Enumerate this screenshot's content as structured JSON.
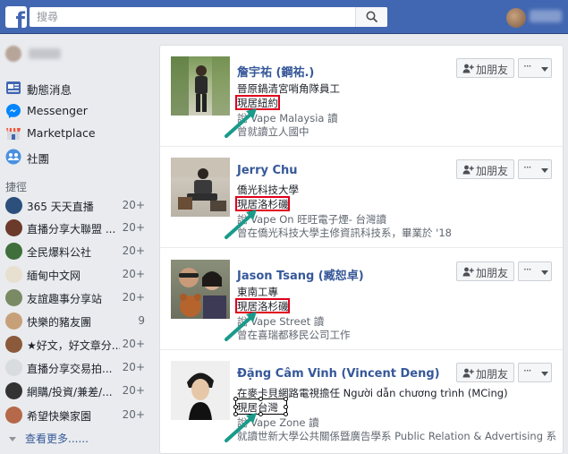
{
  "search": {
    "placeholder": "搜尋"
  },
  "sidebar": {
    "items": [
      {
        "label": "動態消息",
        "icon": "news-feed-icon"
      },
      {
        "label": "Messenger",
        "icon": "messenger-icon"
      },
      {
        "label": "Marketplace",
        "icon": "marketplace-icon"
      },
      {
        "label": "社團",
        "icon": "groups-icon"
      }
    ],
    "shortcuts_title": "捷徑",
    "shortcuts": [
      {
        "label": "365 天天直播",
        "count": "20+"
      },
      {
        "label": "直播分享大聯盟 ...",
        "count": "20+"
      },
      {
        "label": "全民爆料公社",
        "count": "20+"
      },
      {
        "label": "緬甸中文网",
        "count": "20+"
      },
      {
        "label": "友誼趣事分享站",
        "count": "20+"
      },
      {
        "label": "快樂的豬友團",
        "count": "9"
      },
      {
        "label": "★好文，好文章分...",
        "count": "20+"
      },
      {
        "label": "直播分享交易拍...",
        "count": "20+"
      },
      {
        "label": "網購/投資/兼差/...",
        "count": "20+"
      },
      {
        "label": "希望快樂家園",
        "count": "20+"
      }
    ],
    "see_more": "查看更多......"
  },
  "suggestions": [
    {
      "name": "詹宇祐 (鋼祐.)",
      "line1": "晉原鍋清宮哨角隊員工",
      "lives_in": "現居紐約",
      "line3": "說 Vape Malaysia 讀",
      "line4": "曾就讀立人國中"
    },
    {
      "name": "Jerry Chu",
      "line1": "僑光科技大學",
      "lives_in": "現居洛杉磯",
      "line3": "說 Vape On 旺旺電子煙- 台灣讀",
      "line4": "曾在僑光科技大學主修資訊科技系，畢業於 '18"
    },
    {
      "name": "Jason Tsang (臧恕卓)",
      "line1": "東南工專",
      "lives_in": "現居洛杉磯",
      "line3": "說 Vape Street 讀",
      "line4": "曾在喜瑞都移民公司工作"
    },
    {
      "name": "Đặng Câm Vinh (Vincent Deng)",
      "line1": "在麥卡貝網路電視擔任 Người dẫn chương trình (MCing)",
      "lives_in": "現居台灣",
      "line3": "說 Vape Zone 讀",
      "line4": "就讀世新大學公共關係暨廣告學系 Public Relation & Advertising 系"
    }
  ],
  "add_friend_label": "加朋友",
  "more_label": "···",
  "colors": {
    "brand": "#4267b2",
    "link": "#365899",
    "highlight_box": "#e0001b",
    "arrow": "#1a9a8a"
  }
}
